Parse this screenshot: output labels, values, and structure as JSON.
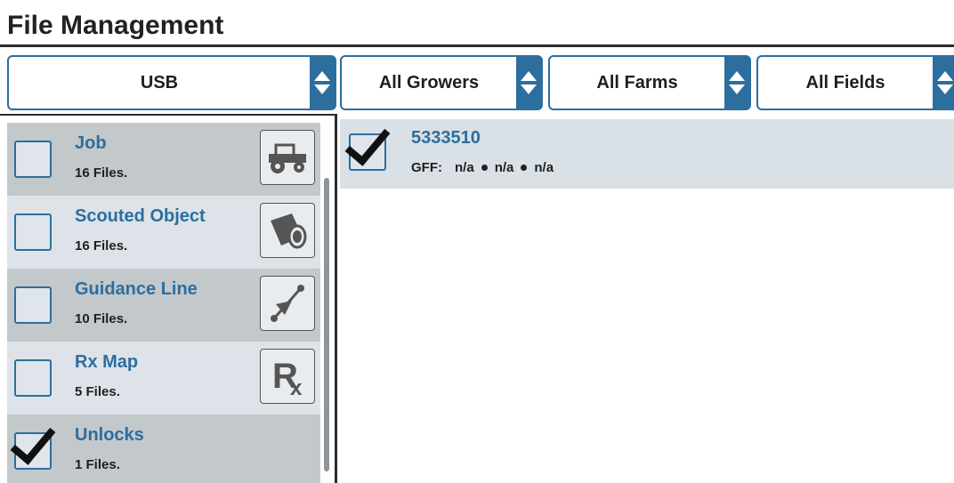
{
  "page": {
    "title": "File Management"
  },
  "filters": {
    "source": "USB",
    "growers": "All Growers",
    "farms": "All Farms",
    "fields": "All Fields"
  },
  "file_types": [
    {
      "name": "Job",
      "count": "16 Files.",
      "icon": "tractor-icon",
      "checked": false
    },
    {
      "name": "Scouted Object",
      "count": "16 Files.",
      "icon": "scouted-object-icon",
      "checked": false
    },
    {
      "name": "Guidance Line",
      "count": "10 Files.",
      "icon": "guidance-line-icon",
      "checked": false
    },
    {
      "name": "Rx Map",
      "count": "5 Files.",
      "icon": "rx-icon",
      "checked": false
    },
    {
      "name": "Unlocks",
      "count": "1 Files.",
      "icon": "",
      "checked": true
    }
  ],
  "files": [
    {
      "id": "5333510",
      "gff_label": "GFF:",
      "grower": "n/a",
      "farm": "n/a",
      "field": "n/a",
      "checked": true
    }
  ],
  "colors": {
    "accent": "#2c6e9e",
    "row_dark": "#c3c8cb",
    "row_light": "#dde3e8"
  }
}
